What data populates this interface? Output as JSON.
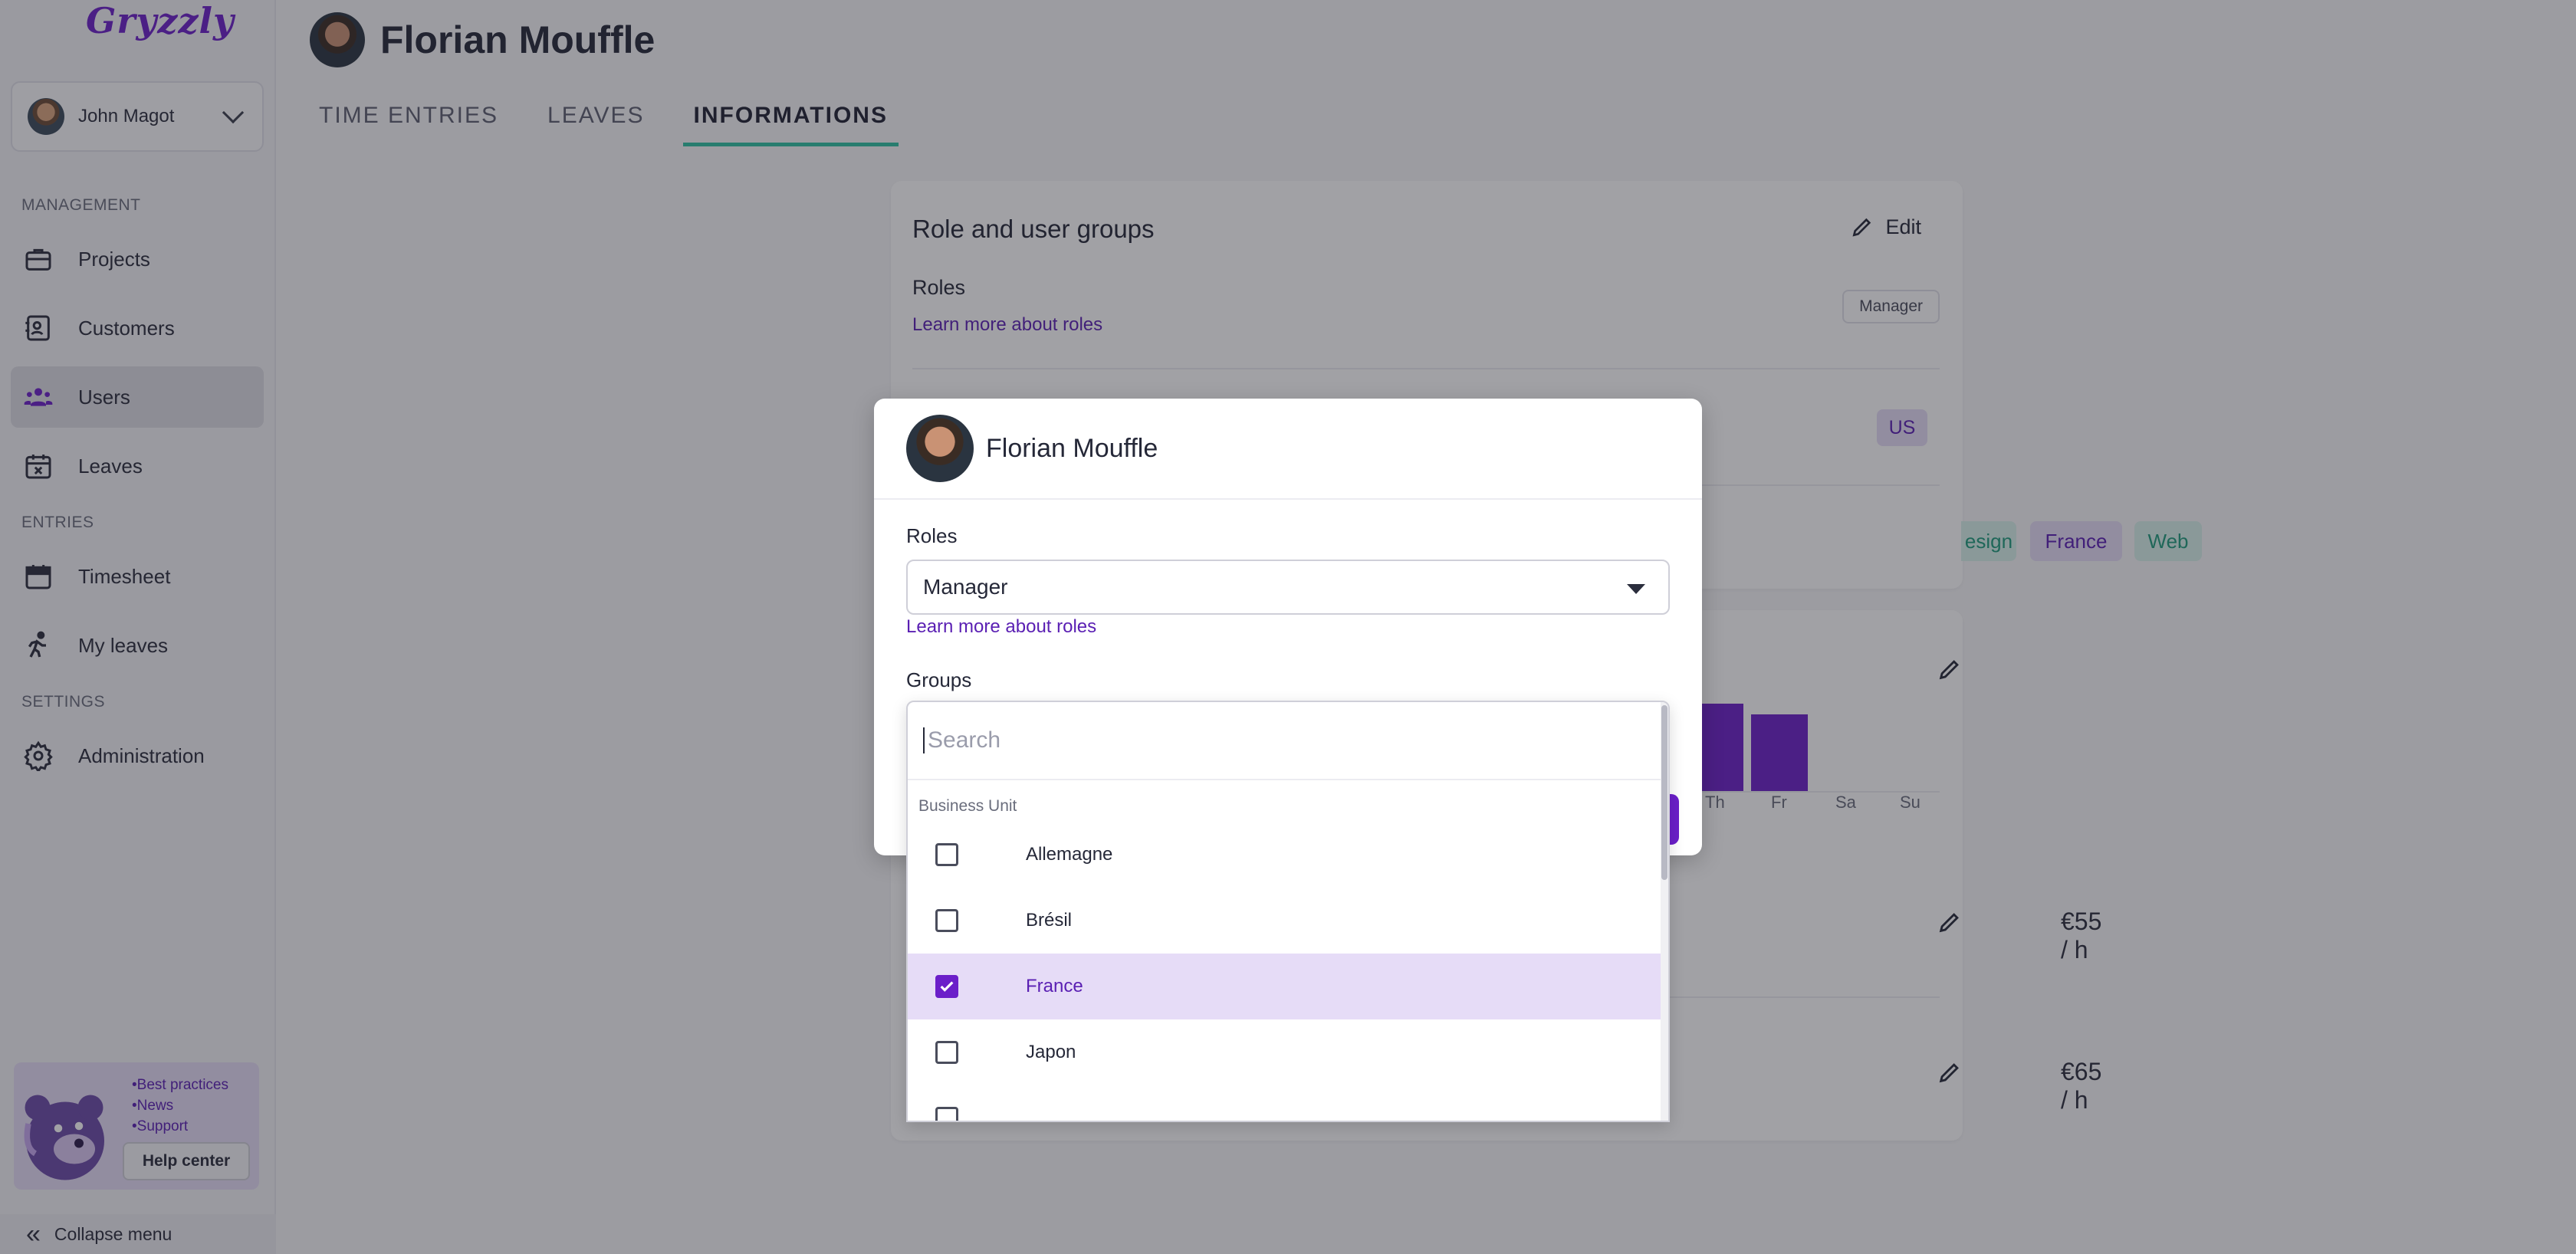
{
  "app": {
    "logo_text": "Gryzzly"
  },
  "sidebar": {
    "user_name": "John Magot",
    "sections": {
      "management": "MANAGEMENT",
      "entries": "ENTRIES",
      "settings": "SETTINGS"
    },
    "items": [
      {
        "label": "Projects",
        "icon": "briefcase-icon"
      },
      {
        "label": "Customers",
        "icon": "contact-card-icon"
      },
      {
        "label": "Users",
        "icon": "users-icon",
        "active": true
      },
      {
        "label": "Leaves",
        "icon": "calendar-x-icon"
      },
      {
        "label": "Timesheet",
        "icon": "calendar-icon"
      },
      {
        "label": "My leaves",
        "icon": "running-icon"
      },
      {
        "label": "Administration",
        "icon": "gear-icon"
      }
    ],
    "help": {
      "links": [
        "•Best practices",
        "•News",
        "•Support"
      ],
      "button_label": "Help center"
    },
    "collapse_label": "Collapse menu"
  },
  "page": {
    "title": "Florian Mouffle",
    "tabs": [
      {
        "label": "TIME ENTRIES"
      },
      {
        "label": "LEAVES"
      },
      {
        "label": "INFORMATIONS",
        "active": true
      }
    ],
    "card1": {
      "title": "Role and user groups",
      "edit_label": "Edit",
      "roles_heading": "Roles",
      "learn_more": "Learn more about roles",
      "role_badge": "Manager",
      "locale_badge": "US",
      "group_tags": [
        "esign",
        "France",
        "Web"
      ]
    },
    "card2": {
      "days": [
        "Th",
        "Fr",
        "Sa",
        "Su"
      ],
      "rates": [
        "€55 / h",
        "€65 / h"
      ]
    }
  },
  "modal": {
    "user_name": "Florian Mouffle",
    "roles_label": "Roles",
    "role_value": "Manager",
    "learn_more": "Learn more about roles",
    "groups_label": "Groups",
    "dropdown": {
      "search_placeholder": "Search",
      "group_header": "Business Unit",
      "options": [
        {
          "label": "Allemagne",
          "checked": false
        },
        {
          "label": "Brésil",
          "checked": false
        },
        {
          "label": "France",
          "checked": true
        },
        {
          "label": "Japon",
          "checked": false
        }
      ]
    }
  },
  "colors": {
    "accent": "#6b1fc9",
    "tab_underline": "#2fc2a2",
    "selected_row": "#e6dcf7"
  }
}
